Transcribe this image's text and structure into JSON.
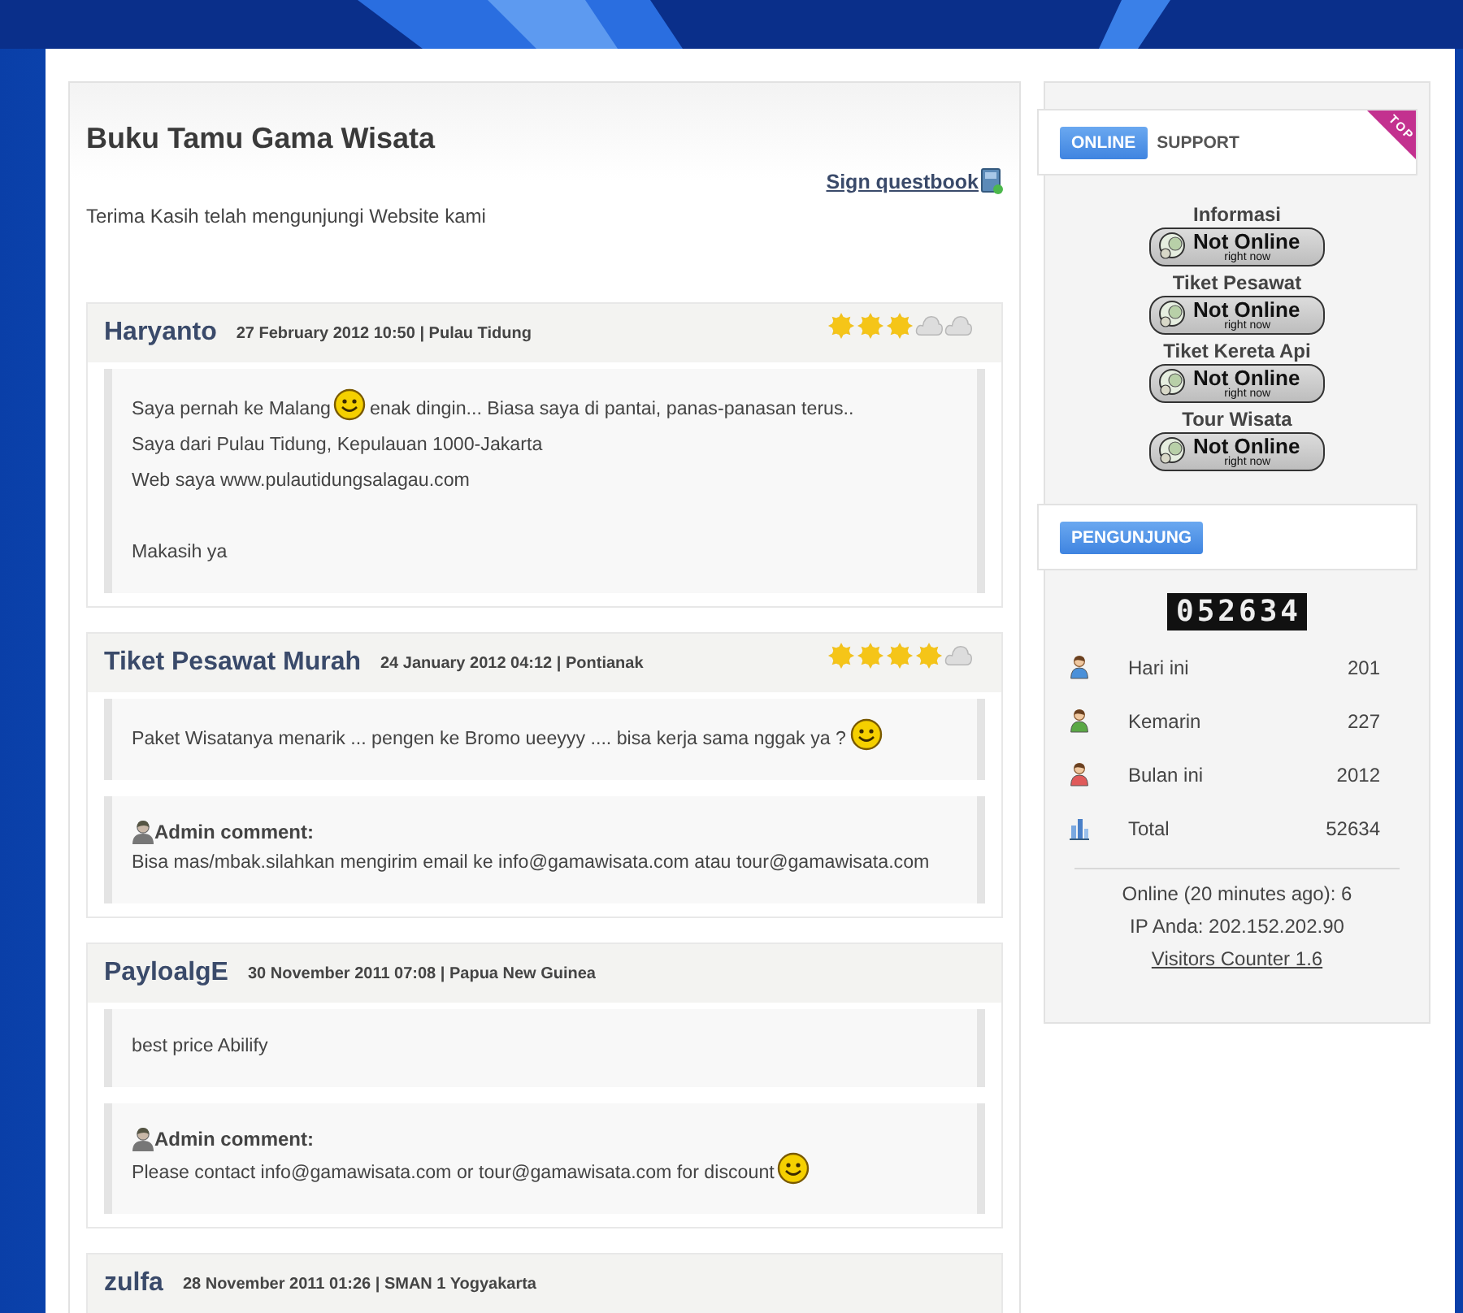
{
  "guestbook": {
    "title": "Buku Tamu Gama Wisata",
    "sign_link": "Sign questbook",
    "intro": "Terima Kasih telah mengunjungi Website kami",
    "entries": [
      {
        "name": "Haryanto",
        "meta": "27 February 2012 10:50 | Pulau Tidung",
        "stars": 3,
        "message": [
          [
            {
              "kind": "text",
              "text": "Saya pernah ke Malang"
            },
            {
              "kind": "smiley"
            },
            {
              "kind": "text",
              "text": "enak dingin... Biasa saya di pantai, panas-panasan terus.."
            }
          ],
          [
            {
              "kind": "text",
              "text": "Saya dari Pulau Tidung, Kepulauan 1000-Jakarta"
            }
          ],
          [
            {
              "kind": "text",
              "text": "Web saya www.pulautidungsalagau.com"
            }
          ],
          [
            {
              "kind": "gap"
            }
          ],
          [
            {
              "kind": "text",
              "text": "Makasih ya"
            }
          ]
        ]
      },
      {
        "name": "Tiket Pesawat Murah",
        "meta": "24 January 2012 04:12 | Pontianak",
        "stars": 4,
        "message": [
          [
            {
              "kind": "text",
              "text": "Paket Wisatanya menarik ... pengen ke Bromo ueeyyy .... bisa kerja sama nggak ya ?"
            },
            {
              "kind": "smiley"
            }
          ]
        ],
        "admin": {
          "label": "Admin comment:",
          "message": [
            {
              "kind": "text",
              "text": "Bisa mas/mbak.silahkan mengirim email ke info@gamawisata.com atau tour@gamawisata.com"
            }
          ]
        }
      },
      {
        "name": "PayloalgE",
        "meta": "30 November 2011 07:08 | Papua New Guinea",
        "message": [
          [
            {
              "kind": "text",
              "text": "best price Abilify"
            }
          ]
        ],
        "admin": {
          "label": "Admin comment:",
          "message": [
            {
              "kind": "text",
              "text": "Please contact info@gamawisata.com or tour@gamawisata.com for discount"
            },
            {
              "kind": "smiley"
            }
          ]
        }
      },
      {
        "name": "zulfa",
        "meta": "28 November 2011 01:26 | SMAN 1 Yogyakarta"
      }
    ]
  },
  "sidebar": {
    "support": {
      "badge": "ONLINE",
      "title": "SUPPORT",
      "ribbon": "TOP",
      "contacts": [
        {
          "name": "Informasi",
          "status": "Not Online",
          "status_note": "right now"
        },
        {
          "name": "Tiket Pesawat",
          "status": "Not Online",
          "status_note": "right now"
        },
        {
          "name": "Tiket Kereta Api",
          "status": "Not Online",
          "status_note": "right now"
        },
        {
          "name": "Tour Wisata",
          "status": "Not Online",
          "status_note": "right now"
        }
      ]
    },
    "visitors": {
      "badge": "PENGUNJUNG",
      "counter": "052634",
      "rows": [
        {
          "kind": "person",
          "color": "#4a90d9",
          "label": "Hari ini",
          "value": "201"
        },
        {
          "kind": "person",
          "color": "#5aa845",
          "label": "Kemarin",
          "value": "227"
        },
        {
          "kind": "person",
          "color": "#e05a5a",
          "label": "Bulan ini",
          "value": "2012"
        },
        {
          "kind": "chart",
          "label": "Total",
          "value": "52634"
        }
      ],
      "online": "Online (20 minutes ago): 6",
      "ip": "IP Anda: 202.152.202.90",
      "link": "Visitors Counter 1.6"
    }
  }
}
